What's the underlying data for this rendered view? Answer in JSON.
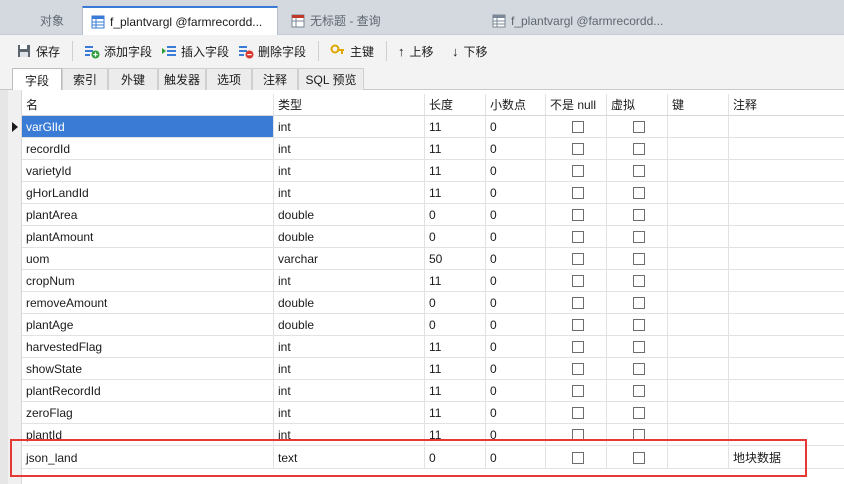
{
  "tabs": [
    {
      "label": "对象",
      "icon": "objects-icon",
      "active": false
    },
    {
      "label": "f_plantvargl @farmrecordd...",
      "icon": "table-icon",
      "active": true
    },
    {
      "label": "无标题 - 查询",
      "icon": "query-icon",
      "active": false
    },
    {
      "label": "f_plantvargl @farmrecordd...",
      "icon": "table-icon",
      "active": false
    }
  ],
  "toolbar": {
    "save": "保存",
    "add_field": "添加字段",
    "insert_field": "插入字段",
    "delete_field": "删除字段",
    "primary_key": "主键",
    "move_up": "上移",
    "move_down": "下移"
  },
  "subtabs": [
    "字段",
    "索引",
    "外键",
    "触发器",
    "选项",
    "注释",
    "SQL 预览"
  ],
  "columns": [
    "名",
    "类型",
    "长度",
    "小数点",
    "不是 null",
    "虚拟",
    "键",
    "注释"
  ],
  "rows": [
    {
      "name": "varGlId",
      "type": "int",
      "length": "11",
      "decimals": "0",
      "comment": ""
    },
    {
      "name": "recordId",
      "type": "int",
      "length": "11",
      "decimals": "0",
      "comment": ""
    },
    {
      "name": "varietyId",
      "type": "int",
      "length": "11",
      "decimals": "0",
      "comment": ""
    },
    {
      "name": "gHorLandId",
      "type": "int",
      "length": "11",
      "decimals": "0",
      "comment": ""
    },
    {
      "name": "plantArea",
      "type": "double",
      "length": "0",
      "decimals": "0",
      "comment": ""
    },
    {
      "name": "plantAmount",
      "type": "double",
      "length": "0",
      "decimals": "0",
      "comment": ""
    },
    {
      "name": "uom",
      "type": "varchar",
      "length": "50",
      "decimals": "0",
      "comment": ""
    },
    {
      "name": "cropNum",
      "type": "int",
      "length": "11",
      "decimals": "0",
      "comment": ""
    },
    {
      "name": "removeAmount",
      "type": "double",
      "length": "0",
      "decimals": "0",
      "comment": ""
    },
    {
      "name": "plantAge",
      "type": "double",
      "length": "0",
      "decimals": "0",
      "comment": ""
    },
    {
      "name": "harvestedFlag",
      "type": "int",
      "length": "11",
      "decimals": "0",
      "comment": ""
    },
    {
      "name": "showState",
      "type": "int",
      "length": "11",
      "decimals": "0",
      "comment": ""
    },
    {
      "name": "plantRecordId",
      "type": "int",
      "length": "11",
      "decimals": "0",
      "comment": ""
    },
    {
      "name": "zeroFlag",
      "type": "int",
      "length": "11",
      "decimals": "0",
      "comment": ""
    },
    {
      "name": "plantId",
      "type": "int",
      "length": "11",
      "decimals": "0",
      "comment": ""
    },
    {
      "name": "json_land",
      "type": "text",
      "length": "0",
      "decimals": "0",
      "comment": "地块数据"
    }
  ],
  "colors": {
    "accent": "#3a7bd5",
    "highlight_box": "#e53935"
  }
}
